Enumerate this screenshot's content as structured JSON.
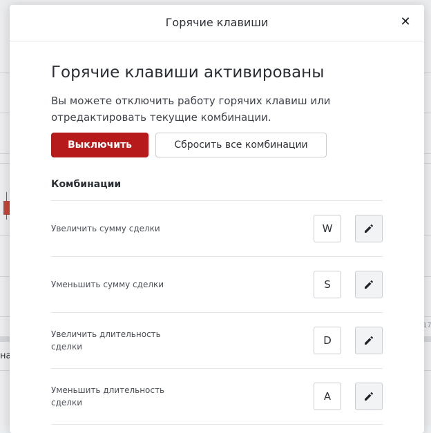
{
  "modal": {
    "title": "Горячие клавиши",
    "close_icon": "close-icon",
    "heading": "Горячие клавиши активированы",
    "description": "Вы можете отключить работу горячих клавиш или отредактировать текущие комбинации.",
    "disable_label": "Выключить",
    "reset_label": "Сбросить все комбинации",
    "section_title": "Комбинации",
    "accent_color": "#b61a1a",
    "rows": [
      {
        "label": "Увеличить сумму сделки",
        "key": "W",
        "edit_icon": "pencil-icon"
      },
      {
        "label": "Уменьшить сумму сделки",
        "key": "S",
        "edit_icon": "pencil-icon"
      },
      {
        "label": "Увеличить длительность сделки",
        "key": "D",
        "edit_icon": "pencil-icon"
      },
      {
        "label": "Уменьшить длительность сделки",
        "key": "A",
        "edit_icon": "pencil-icon"
      }
    ]
  },
  "background": {
    "left_fragment": "на",
    "right_fragment": "17"
  }
}
